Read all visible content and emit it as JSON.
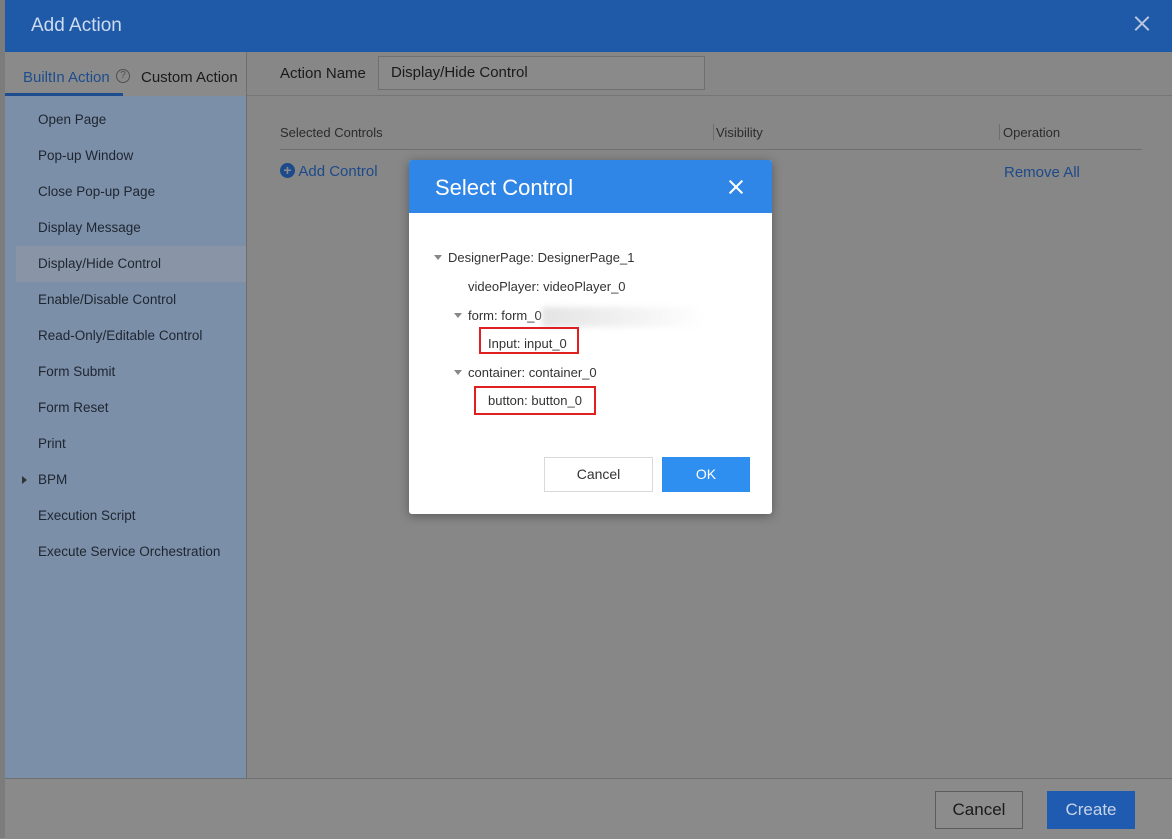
{
  "dialog": {
    "title": "Add Action",
    "tabs": {
      "builtin": "BuiltIn Action",
      "custom": "Custom Action",
      "help": "?"
    },
    "action_name_label": "Action Name",
    "action_name_value": "Display/Hide Control",
    "sidebar": {
      "items": [
        {
          "label": "Open Page"
        },
        {
          "label": "Pop-up Window"
        },
        {
          "label": "Close Pop-up Page"
        },
        {
          "label": "Display Message"
        },
        {
          "label": "Display/Hide Control",
          "active": true
        },
        {
          "label": "Enable/Disable Control"
        },
        {
          "label": "Read-Only/Editable Control"
        },
        {
          "label": "Form Submit"
        },
        {
          "label": "Form Reset"
        },
        {
          "label": "Print"
        },
        {
          "label": "BPM",
          "expandable": true
        },
        {
          "label": "Execution Script"
        },
        {
          "label": "Execute Service Orchestration"
        }
      ]
    },
    "table": {
      "columns": [
        "Selected Controls",
        "Visibility",
        "Operation"
      ],
      "add_control": "Add Control",
      "remove_all": "Remove All"
    },
    "footer": {
      "cancel": "Cancel",
      "create": "Create"
    }
  },
  "modal": {
    "title": "Select Control",
    "tree": {
      "root": "DesignerPage: DesignerPage_1",
      "video": "videoPlayer: videoPlayer_0",
      "form": "form: form_0",
      "input": "Input: input_0",
      "container": "container: container_0",
      "button": "button: button_0"
    },
    "cancel": "Cancel",
    "ok": "OK"
  },
  "colors": {
    "header_blue": "#2f86e6",
    "ok_blue": "#2f8ff0",
    "highlight_red": "#e02020"
  }
}
